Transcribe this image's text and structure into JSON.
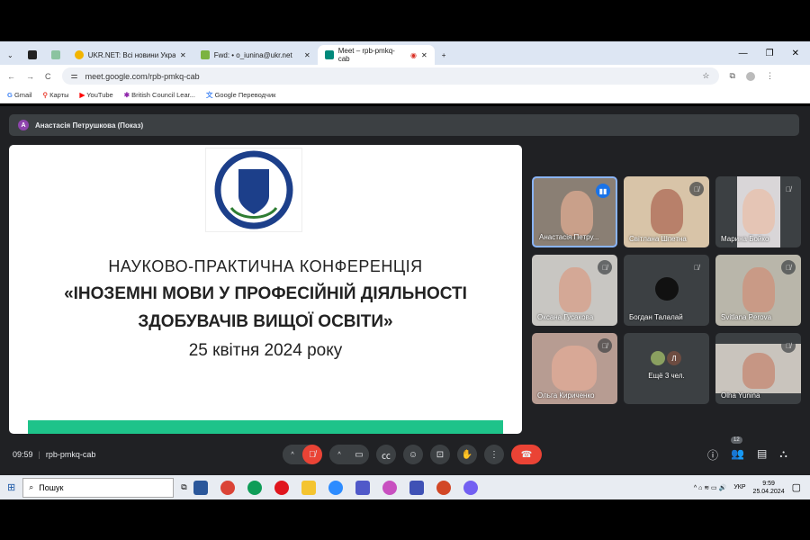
{
  "browser": {
    "tabs": [
      {
        "label": "UKR.NET: Всі новини України"
      },
      {
        "label": "Fwd: • o_iunina@ukr.net"
      },
      {
        "label": "Meet – rpb-pmkq-cab"
      }
    ],
    "url": "meet.google.com/rpb-pmkq-cab",
    "bookmarks": [
      "Gmail",
      "Карты",
      "YouTube",
      "British Council Lear...",
      "Google Переводчик"
    ]
  },
  "meet": {
    "presenter": "Анастасія Петрушкова (Показ)",
    "presenter_initial": "A",
    "slide": {
      "line1": "НАУКОВО-ПРАКТИЧНА КОНФЕРЕНЦІЯ",
      "line2": "«ІНОЗЕМНІ МОВИ У ПРОФЕСІЙНІЙ ДІЯЛЬНОСТІ",
      "line3": "ЗДОБУВАЧІВ ВИЩОЇ ОСВІТИ»",
      "line4": "25 квітня 2024 року"
    },
    "participants": [
      "Анастасія Петру...",
      "Світлана Шпетна",
      "Марина Бойко",
      "Оксана Гусакова",
      "Богдан Талалай",
      "Svitlana Perova",
      "Ольга Кириченко",
      "Ещё 3 чел.",
      "Olha Yunina"
    ],
    "others_initial": "Л",
    "time": "09:59",
    "meeting_code": "rpb-pmkq-cab",
    "people_count": "12"
  },
  "taskbar": {
    "search_placeholder": "Пошук",
    "lang": "УКР",
    "clock": "9:59",
    "date": "25.04.2024"
  }
}
